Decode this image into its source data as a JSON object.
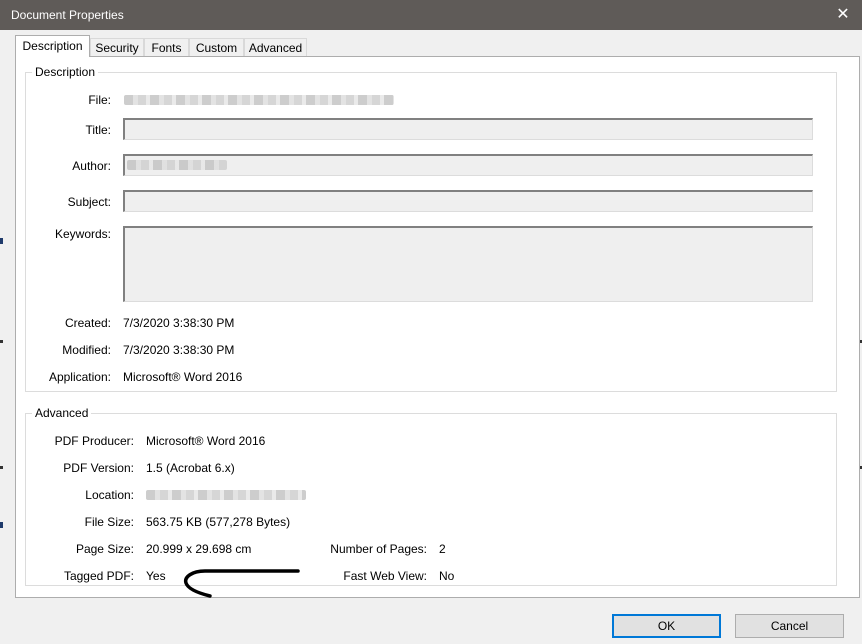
{
  "window": {
    "title": "Document Properties",
    "close_symbol": "✕"
  },
  "tabs": [
    {
      "label": "Description",
      "active": true
    },
    {
      "label": "Security"
    },
    {
      "label": "Fonts"
    },
    {
      "label": "Custom"
    },
    {
      "label": "Advanced"
    }
  ],
  "description": {
    "group_title": "Description",
    "file_label": "File:",
    "title_label": "Title:",
    "title_value": "",
    "author_label": "Author:",
    "subject_label": "Subject:",
    "subject_value": "",
    "keywords_label": "Keywords:",
    "keywords_value": "",
    "created_label": "Created:",
    "created_value": "7/3/2020 3:38:30 PM",
    "modified_label": "Modified:",
    "modified_value": "7/3/2020 3:38:30 PM",
    "application_label": "Application:",
    "application_value": "Microsoft® Word 2016"
  },
  "advanced": {
    "group_title": "Advanced",
    "producer_label": "PDF Producer:",
    "producer_value": "Microsoft® Word 2016",
    "version_label": "PDF Version:",
    "version_value": "1.5 (Acrobat 6.x)",
    "location_label": "Location:",
    "filesize_label": "File Size:",
    "filesize_value": "563.75 KB (577,278 Bytes)",
    "pagesize_label": "Page Size:",
    "pagesize_value": "20.999 x 29.698 cm",
    "pages_label": "Number of Pages:",
    "pages_value": "2",
    "tagged_label": "Tagged PDF:",
    "tagged_value": "Yes",
    "fastweb_label": "Fast Web View:",
    "fastweb_value": "No"
  },
  "buttons": {
    "ok": "OK",
    "cancel": "Cancel"
  },
  "icons": {
    "close": "close-icon",
    "annotation": "arrow-annotation-icon"
  }
}
